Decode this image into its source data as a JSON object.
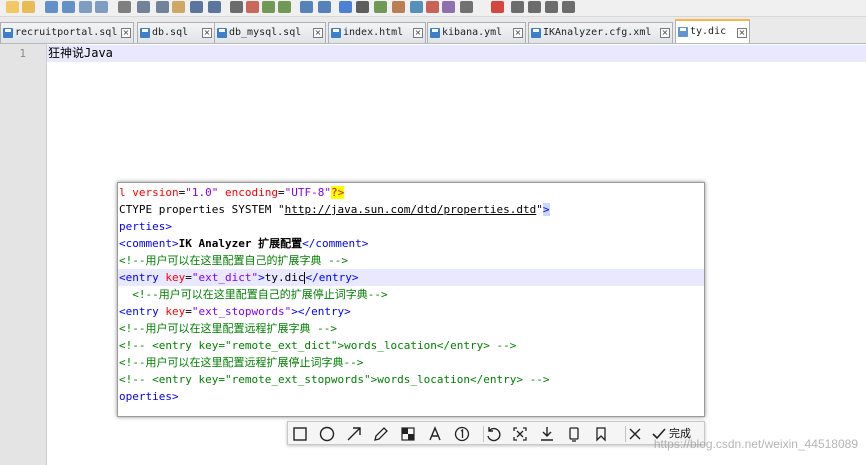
{
  "toolbar": {
    "icons": [
      "new-file",
      "open-file",
      "save",
      "save-all",
      "close",
      "close-all",
      "print",
      "cut",
      "copy",
      "paste",
      "undo",
      "redo",
      "find",
      "replace",
      "zoom-in",
      "zoom-out",
      "sync-vertical",
      "sync-horizontal",
      "word-wrap",
      "show-all-chars",
      "indent-guide",
      "user-language",
      "doc-map",
      "function-list",
      "folder-workspace",
      "monitoring",
      "record-macro",
      "stop-macro",
      "play-macro",
      "run-macro-multiple",
      "save-macro"
    ]
  },
  "tabs": [
    {
      "label": "recruitportal.sql",
      "active": false
    },
    {
      "label": "db.sql",
      "active": false
    },
    {
      "label": "db_mysql.sql",
      "active": false
    },
    {
      "label": "index.html",
      "active": false
    },
    {
      "label": "kibana.yml",
      "active": false
    },
    {
      "label": "IKAnalyzer.cfg.xml",
      "active": false
    },
    {
      "label": "ty.dic",
      "active": true
    }
  ],
  "editor": {
    "line_number": "1",
    "line_text": "狂神说Java"
  },
  "popup": {
    "lines": [
      {
        "parts": [
          [
            "t-attr",
            "l version"
          ],
          [
            "t-txt",
            "="
          ],
          [
            "t-val",
            "\"1.0\""
          ],
          [
            "t-txt",
            " "
          ],
          [
            "t-attr",
            "encoding"
          ],
          [
            "t-txt",
            "="
          ],
          [
            "t-val",
            "\"UTF-8\""
          ],
          [
            "t-pi",
            "?>"
          ]
        ]
      },
      {
        "parts": [
          [
            "t-txt",
            "CTYPE properties SYSTEM \""
          ],
          [
            "t-link",
            "http://java.sun.com/dtd/properties.dtd"
          ],
          [
            "t-txt",
            "\""
          ],
          [
            "t-blue-end",
            ">"
          ]
        ]
      },
      {
        "parts": [
          [
            "t-tag",
            "perties>"
          ]
        ]
      },
      {
        "parts": [
          [
            "t-tag",
            "<comment>"
          ],
          [
            "t-bold",
            "IK Analyzer 扩展配置"
          ],
          [
            "t-tag",
            "</comment>"
          ]
        ]
      },
      {
        "parts": [
          [
            "t-com",
            "<!--用户可以在这里配置自己的扩展字典 -->"
          ]
        ]
      },
      {
        "hl": true,
        "parts": [
          [
            "t-tag",
            "<entry "
          ],
          [
            "t-attr",
            "key"
          ],
          [
            "t-txt",
            "="
          ],
          [
            "t-val",
            "\"ext_dict\""
          ],
          [
            "t-tag",
            ">"
          ],
          [
            "t-txt",
            "ty.dic"
          ],
          [
            "caret",
            ""
          ],
          [
            "t-tag",
            "</entry>"
          ]
        ]
      },
      {
        "parts": [
          [
            "t-com",
            "  <!--用户可以在这里配置自己的扩展停止词字典-->"
          ]
        ]
      },
      {
        "parts": [
          [
            "t-tag",
            "<entry "
          ],
          [
            "t-attr",
            "key"
          ],
          [
            "t-txt",
            "="
          ],
          [
            "t-val",
            "\"ext_stopwords\""
          ],
          [
            "t-tag",
            "></entry>"
          ]
        ]
      },
      {
        "parts": [
          [
            "t-com",
            "<!--用户可以在这里配置远程扩展字典 -->"
          ]
        ]
      },
      {
        "parts": [
          [
            "t-com",
            "<!-- <entry key=\"remote_ext_dict\">words_location</entry> -->"
          ]
        ]
      },
      {
        "parts": [
          [
            "t-com",
            "<!--用户可以在这里配置远程扩展停止词字典-->"
          ]
        ]
      },
      {
        "parts": [
          [
            "t-com",
            "<!-- <entry key=\"remote_ext_stopwords\">words_location</entry> -->"
          ]
        ]
      },
      {
        "parts": [
          [
            "t-tag",
            "operties>"
          ]
        ]
      }
    ]
  },
  "snip_toolbar": {
    "tools": [
      "rectangle-icon",
      "ellipse-icon",
      "arrow-icon",
      "pencil-icon",
      "mosaic-icon",
      "text-icon",
      "number-icon",
      "undo-icon",
      "ocr-icon",
      "download-icon",
      "pin-icon",
      "bookmark-icon",
      "close-icon"
    ],
    "done_label": "完成"
  },
  "watermark": "https://blog.csdn.net/weixin_44518089",
  "colors": {
    "accent_tab": "#fcb449",
    "tag": "#0000ff",
    "attr": "#ff0000",
    "value": "#8000ff",
    "comment": "#008000"
  }
}
